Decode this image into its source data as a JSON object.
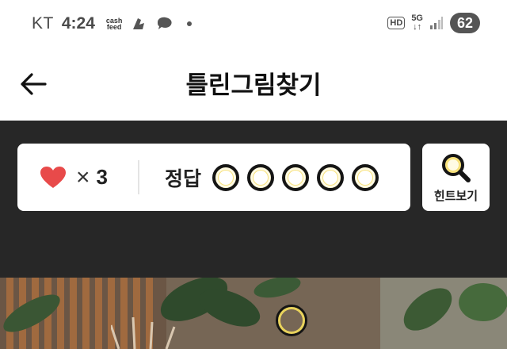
{
  "status_bar": {
    "carrier": "KT",
    "time": "4:24",
    "app_icon_text_1": "cash",
    "app_icon_text_2": "feed",
    "hd": "HD",
    "network": "5G",
    "battery": "62"
  },
  "app_bar": {
    "title": "틀린그림찾기"
  },
  "info_card": {
    "lives_count": "3",
    "times_symbol": "×",
    "answers_label": "정답",
    "answer_slots": 5,
    "answers_found": 0
  },
  "hint_button": {
    "label": "힌트보기"
  },
  "colors": {
    "heart": "#e84a4a",
    "accent_yellow": "#f7e17a",
    "dark_bg": "#272727"
  }
}
